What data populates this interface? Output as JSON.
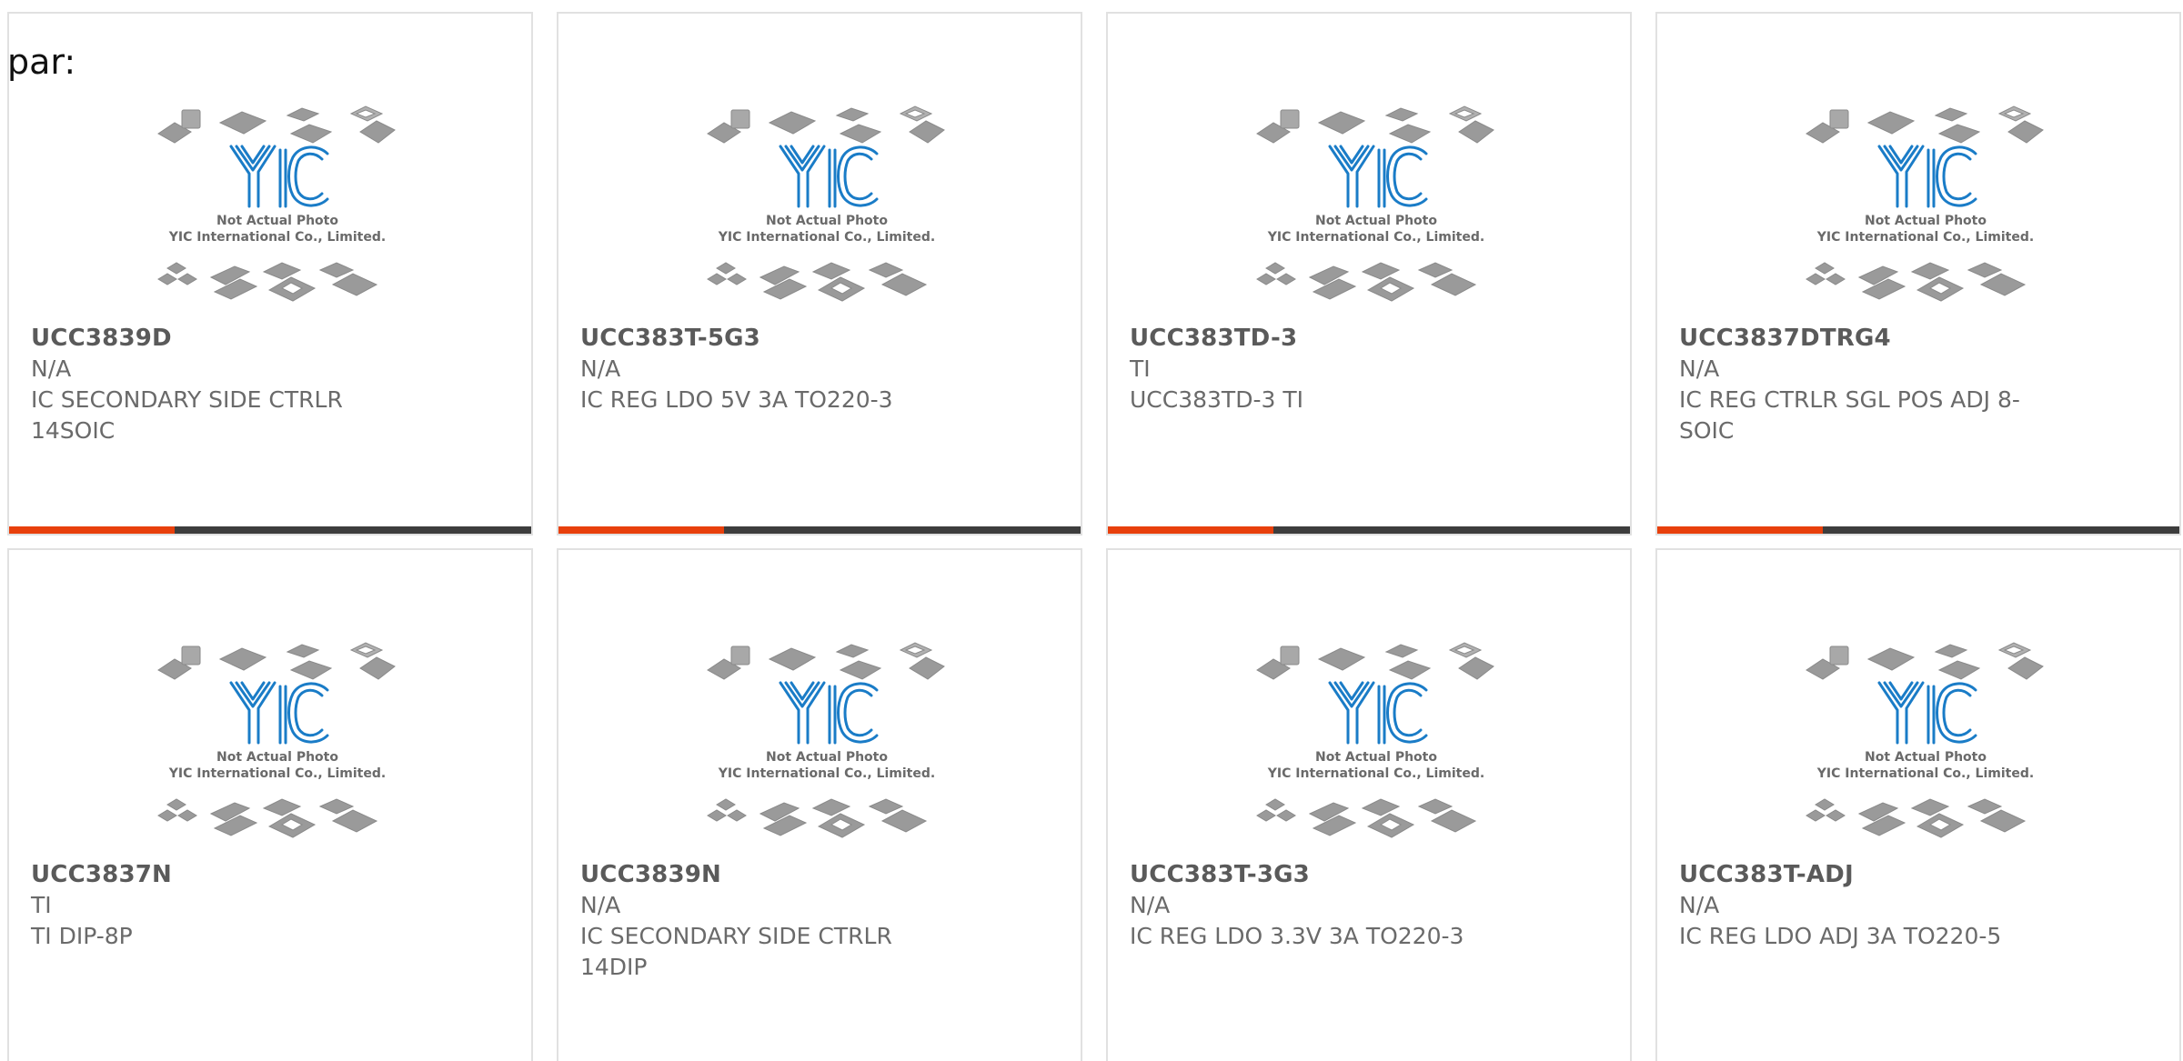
{
  "label": "par:",
  "colors": {
    "accent": "#e8400c",
    "bar": "#3d3d3d",
    "logo_blue": "#1a7cc7"
  },
  "thumbnail": {
    "logo_text": "YIC",
    "caption_1": "Not Actual Photo",
    "caption_2": "YIC International Co., Limited."
  },
  "products": [
    {
      "part": "UCC3839D",
      "mfr": "N/A",
      "desc": "IC SECONDARY SIDE CTRLR 14SOIC"
    },
    {
      "part": "UCC383T-5G3",
      "mfr": "N/A",
      "desc": "IC REG LDO 5V 3A TO220-3"
    },
    {
      "part": "UCC383TD-3",
      "mfr": "TI",
      "desc": "UCC383TD-3 TI"
    },
    {
      "part": "UCC3837DTRG4",
      "mfr": "N/A",
      "desc": "IC REG CTRLR SGL POS ADJ 8-SOIC"
    },
    {
      "part": "UCC3837N",
      "mfr": "TI",
      "desc": "TI DIP-8P"
    },
    {
      "part": "UCC3839N",
      "mfr": "N/A",
      "desc": "IC SECONDARY SIDE CTRLR 14DIP"
    },
    {
      "part": "UCC383T-3G3",
      "mfr": "N/A",
      "desc": "IC REG LDO 3.3V 3A TO220-3"
    },
    {
      "part": "UCC383T-ADJ",
      "mfr": "N/A",
      "desc": "IC REG LDO ADJ 3A TO220-5"
    }
  ]
}
